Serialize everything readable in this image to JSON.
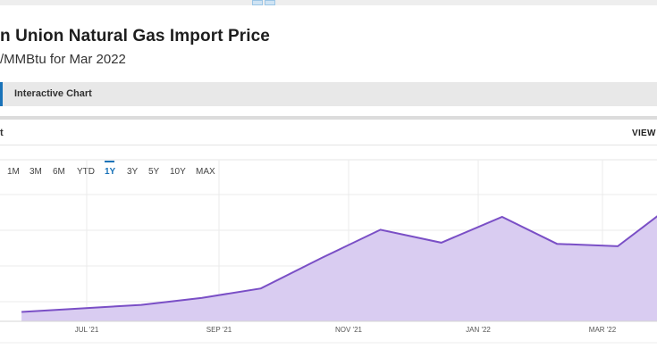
{
  "header": {
    "title": "n Union Natural Gas Import Price",
    "subtitle": "/MMBtu for Mar 2022"
  },
  "tabs": [
    {
      "label": "Interactive Chart",
      "active": true
    }
  ],
  "panel": {
    "left_label": "t",
    "view_full": "VIEW I"
  },
  "ranges": {
    "items": [
      "1M",
      "3M",
      "6M",
      "YTD",
      "1Y",
      "3Y",
      "5Y",
      "10Y",
      "MAX"
    ],
    "selected": "1Y"
  },
  "colors": {
    "accent": "#1a73b9",
    "line": "#7a4fc6",
    "fill": "#d9ccf1"
  },
  "chart_data": {
    "type": "area",
    "x": [
      "2021-05-31",
      "2021-07-31",
      "2021-08-31",
      "2021-09-30",
      "2021-10-31",
      "2021-11-30",
      "2021-12-31",
      "2022-01-31",
      "2022-02-28",
      "2022-03-31",
      "2022-04-30"
    ],
    "x_ticks": [
      "JUL '21",
      "SEP '21",
      "NOV '21",
      "JAN '22",
      "MAR '22"
    ],
    "series": [
      {
        "values": [
          1.0,
          1.6,
          2.2,
          3.0,
          5.6,
          8.0,
          6.9,
          9.1,
          6.8,
          6.6,
          10.4
        ]
      }
    ],
    "grid": true
  }
}
